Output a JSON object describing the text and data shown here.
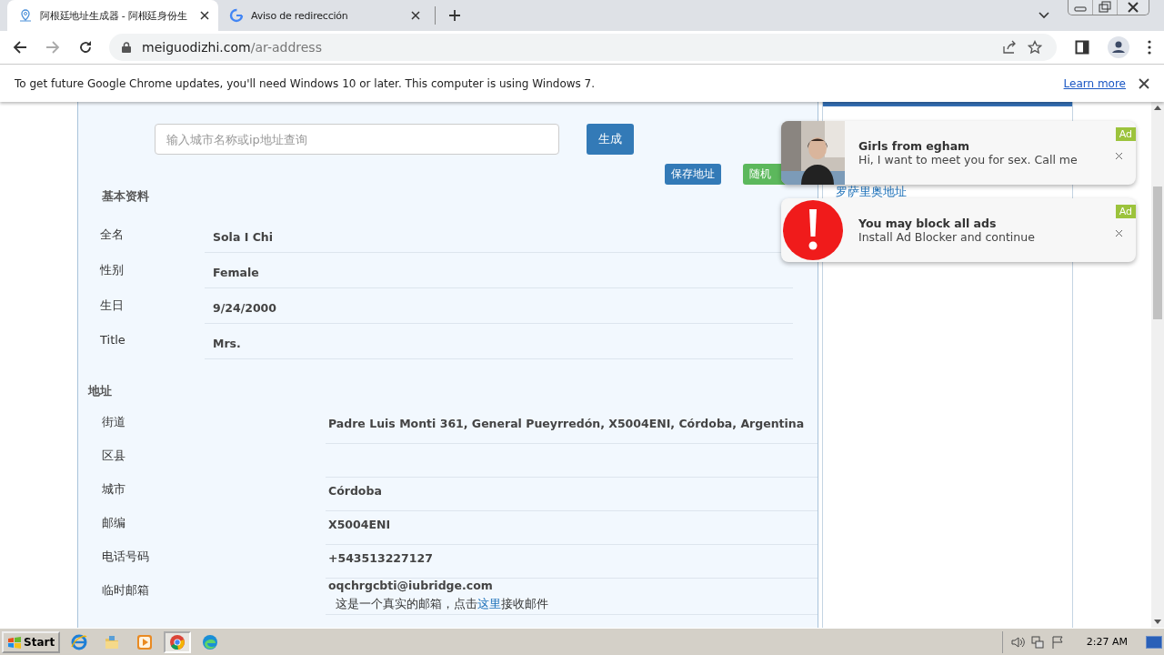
{
  "browser": {
    "tabs": [
      {
        "title": "阿根廷地址生成器 - 阿根廷身份生",
        "kind": "site",
        "selected": true
      },
      {
        "title": "Aviso de redirección",
        "kind": "google",
        "selected": false
      }
    ],
    "address": {
      "domain": "meiguodizhi.com",
      "path": "/ar-address"
    }
  },
  "infobar": {
    "message": "To get future Google Chrome updates, you'll need Windows 10 or later. This computer is using Windows 7.",
    "link": "Learn more"
  },
  "form": {
    "placeholder": "输入城市名称或ip地址查询",
    "generate": "生成",
    "actions": [
      {
        "label": "保存地址",
        "kind": "primary"
      },
      {
        "label": "随机",
        "kind": "success"
      }
    ]
  },
  "sections": [
    {
      "title": "基本资料",
      "kind": "basic",
      "rows": [
        {
          "label": "全名",
          "value": "Sola I Chi"
        },
        {
          "label": "性别",
          "value": "Female"
        },
        {
          "label": "生日",
          "value": "9/24/2000"
        },
        {
          "label": "Title",
          "value": "Mrs."
        }
      ]
    },
    {
      "title": "地址",
      "kind": "address",
      "rows": [
        {
          "label": "街道",
          "value": "Padre Luis Monti 361, General Pueyrredón, X5004ENI, Córdoba, Argentina"
        },
        {
          "label": "区县"
        },
        {
          "label": "城市",
          "value": "Córdoba"
        },
        {
          "label": "邮编",
          "value": "X5004ENI"
        },
        {
          "label": "电话号码",
          "value": "+543513227127"
        },
        {
          "label": "临时邮箱",
          "value": "oqchrgcbti@iubridge.com",
          "note": {
            "before": "这是一个真实的邮箱，点击",
            "link": "这里",
            "after": "接收邮件"
          }
        }
      ]
    }
  ],
  "sidebar": {
    "links": [
      "罗萨里奥地址"
    ]
  },
  "ads": [
    {
      "title": "Girls from  egham",
      "text": "Hi, I want to meet you for sex. Call me",
      "badge": "Ad"
    },
    {
      "kind": "alert",
      "title": "You may block all ads",
      "text": "Install Ad Blocker and continue",
      "badge": "Ad"
    }
  ],
  "taskbar": {
    "start": "Start",
    "apps": [
      {
        "kind": "ie",
        "selected": false
      },
      {
        "kind": "folder",
        "selected": false
      },
      {
        "kind": "media",
        "selected": false
      },
      {
        "kind": "chrome",
        "selected": true
      },
      {
        "kind": "edge",
        "selected": false
      }
    ],
    "clock": "2:27 AM"
  }
}
